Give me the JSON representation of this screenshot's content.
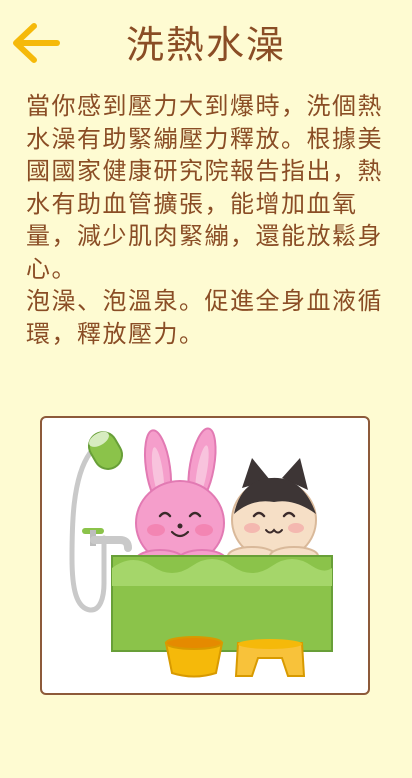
{
  "header": {
    "title": "洗熱水澡",
    "back_icon": "arrow-left-icon",
    "accent_color": "#f5b90a",
    "text_color": "#8a4d25"
  },
  "content": {
    "paragraph_1": "當你感到壓力大到爆時，洗個熱水澡有助緊繃壓力釋放。根據美國國家健康研究院報告指出，熱水有助血管擴張，能增加血氧量，減少肌肉緊繃，還能放鬆身心。",
    "paragraph_2": "泡澡、泡溫泉。促進全身血液循環，釋放壓力。"
  },
  "illustration": {
    "subject": "rabbit-and-cat-in-bathtub",
    "background": "#fefbd2"
  }
}
